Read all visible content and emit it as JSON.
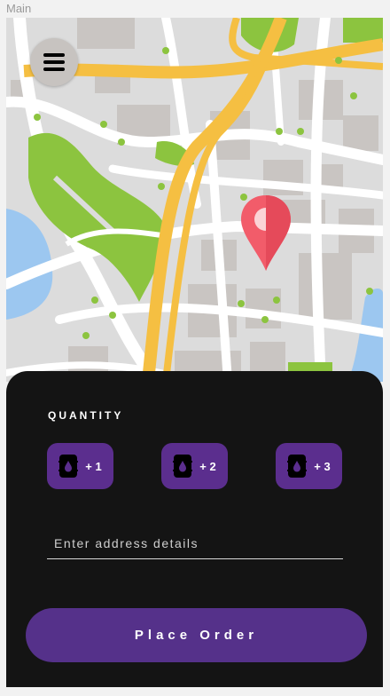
{
  "frame": {
    "label": "Main"
  },
  "map": {
    "colors": {
      "road": "#ffffff",
      "highway": "#f5bf42",
      "park": "#8cc43f",
      "water": "#9cc7f0",
      "block": "#c9c5c2",
      "pin": "#f25c6a"
    }
  },
  "menu": {
    "icon": "hamburger-icon"
  },
  "quantity": {
    "title": "QUANTITY",
    "options": [
      {
        "label": "+ 1",
        "icon": "water-drum-icon"
      },
      {
        "label": "+ 2",
        "icon": "water-drum-icon"
      },
      {
        "label": "+ 3",
        "icon": "water-drum-icon"
      }
    ]
  },
  "address": {
    "placeholder": "Enter address details",
    "value": ""
  },
  "order": {
    "label": "Place Order"
  },
  "colors": {
    "sheet": "#141414",
    "accent": "#5b2e8e"
  }
}
